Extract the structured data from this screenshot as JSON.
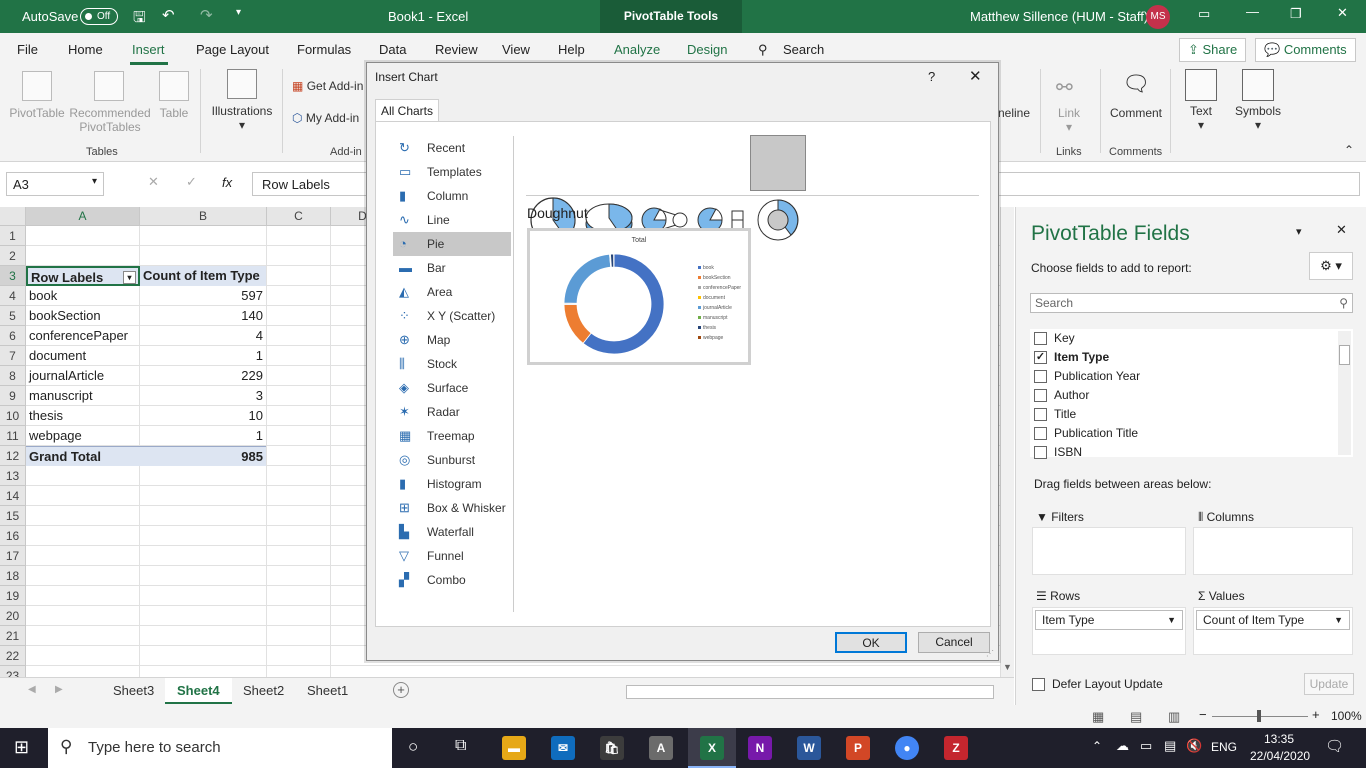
{
  "titlebar": {
    "autosave_label": "AutoSave",
    "autosave_state": "Off",
    "doc_title": "Book1  -  Excel",
    "context_tab": "PivotTable Tools",
    "user_name": "Matthew Sillence (HUM - Staff)",
    "user_initials": "MS"
  },
  "menu": {
    "items": [
      "File",
      "Home",
      "Insert",
      "Page Layout",
      "Formulas",
      "Data",
      "Review",
      "View",
      "Help",
      "Analyze",
      "Design"
    ],
    "search": "Search",
    "share": "Share",
    "comments": "Comments"
  },
  "ribbon": {
    "tables": {
      "pivot": "PivotTable",
      "recommended": "Recommended",
      "recommended2": "PivotTables",
      "table": "Table",
      "group": "Tables"
    },
    "illustrations": "Illustrations",
    "addins": {
      "get": "Get Add-in",
      "my": "My Add-in",
      "group": "Add-in"
    },
    "timeline": "neline",
    "link": "Link",
    "links_group": "Links",
    "comment": "Comment",
    "comments_group": "Comments",
    "text": "Text",
    "symbols": "Symbols"
  },
  "formula": {
    "namebox": "A3",
    "fx": "fx",
    "content": "Row Labels"
  },
  "grid": {
    "columns": [
      "A",
      "B",
      "C",
      "D"
    ],
    "rows": [
      "1",
      "2",
      "3",
      "4",
      "5",
      "6",
      "7",
      "8",
      "9",
      "10",
      "11",
      "12",
      "13",
      "14",
      "15",
      "16",
      "17",
      "18",
      "19",
      "20",
      "21",
      "22",
      "23"
    ],
    "header": {
      "a": "Row Labels",
      "b": "Count of Item Type"
    },
    "data": [
      [
        "book",
        "597"
      ],
      [
        "bookSection",
        "140"
      ],
      [
        "conferencePaper",
        "4"
      ],
      [
        "document",
        "1"
      ],
      [
        "journalArticle",
        "229"
      ],
      [
        "manuscript",
        "3"
      ],
      [
        "thesis",
        "10"
      ],
      [
        "webpage",
        "1"
      ]
    ],
    "total": {
      "a": "Grand Total",
      "b": "985"
    }
  },
  "sheets": [
    "Sheet3",
    "Sheet4",
    "Sheet2",
    "Sheet1"
  ],
  "status": {
    "zoom": "100%"
  },
  "pivot": {
    "title": "PivotTable Fields",
    "subtitle": "Choose fields to add to report:",
    "search_placeholder": "Search",
    "fields": [
      {
        "name": "Key",
        "checked": false
      },
      {
        "name": "Item Type",
        "checked": true
      },
      {
        "name": "Publication Year",
        "checked": false
      },
      {
        "name": "Author",
        "checked": false
      },
      {
        "name": "Title",
        "checked": false
      },
      {
        "name": "Publication Title",
        "checked": false
      },
      {
        "name": "ISBN",
        "checked": false
      }
    ],
    "drag_label": "Drag fields between areas below:",
    "filters": "Filters",
    "columns": "Columns",
    "rows": "Rows",
    "values": "Values",
    "rows_field": "Item Type",
    "values_field": "Count of Item Type",
    "defer": "Defer Layout Update",
    "update": "Update"
  },
  "dialog": {
    "title": "Insert Chart",
    "help": "?",
    "tab": "All Charts",
    "types": [
      "Recent",
      "Templates",
      "Column",
      "Line",
      "Pie",
      "Bar",
      "Area",
      "X Y (Scatter)",
      "Map",
      "Stock",
      "Surface",
      "Radar",
      "Treemap",
      "Sunburst",
      "Histogram",
      "Box & Whisker",
      "Waterfall",
      "Funnel",
      "Combo"
    ],
    "selected_type": "Pie",
    "subtype_name": "Doughnut",
    "preview_title": "Total",
    "legend": [
      "book",
      "bookSection",
      "conferencePaper",
      "document",
      "journalArticle",
      "manuscript",
      "thesis",
      "webpage"
    ],
    "ok": "OK",
    "cancel": "Cancel"
  },
  "chart_data": {
    "type": "pie",
    "title": "Total",
    "categories": [
      "book",
      "bookSection",
      "conferencePaper",
      "document",
      "journalArticle",
      "manuscript",
      "thesis",
      "webpage"
    ],
    "values": [
      597,
      140,
      4,
      1,
      229,
      3,
      10,
      1
    ],
    "colors": [
      "#4472c4",
      "#ed7d31",
      "#a5a5a5",
      "#ffc000",
      "#5b9bd5",
      "#70ad47",
      "#264478",
      "#9e480e"
    ]
  },
  "taskbar": {
    "search": "Type here to search",
    "lang": "ENG",
    "time": "13:35",
    "date": "22/04/2020"
  }
}
